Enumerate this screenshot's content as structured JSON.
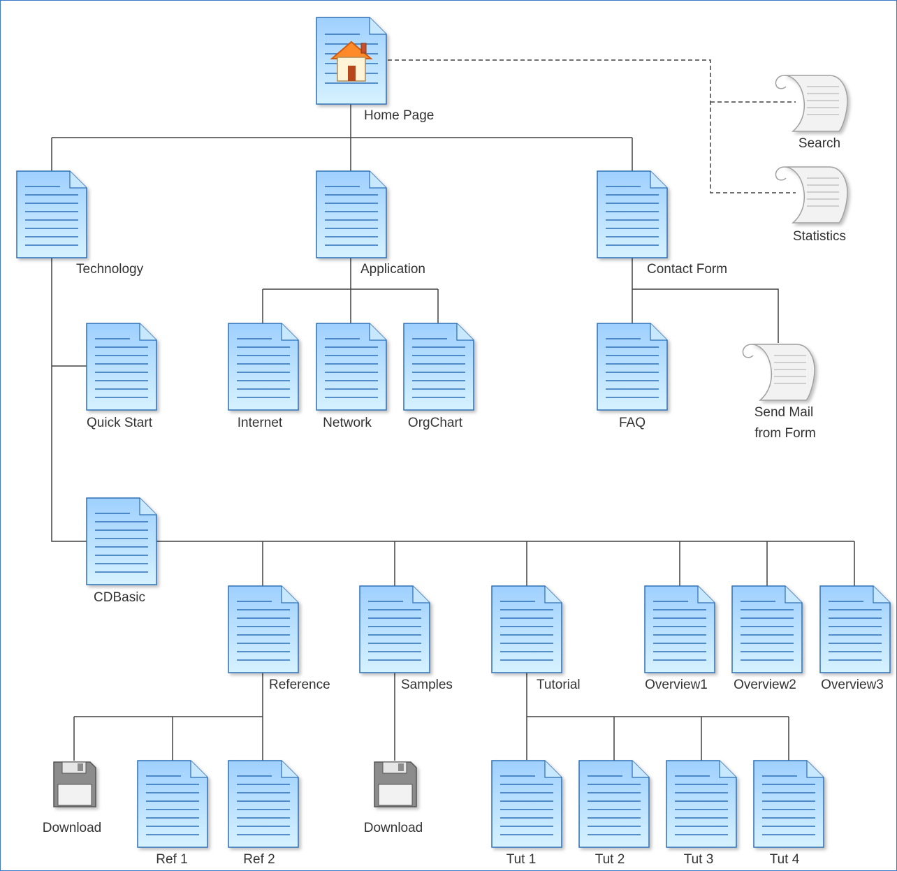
{
  "colors": {
    "doc_top": "#9fd0ff",
    "doc_bottom": "#d6f2ff",
    "doc_border": "#2d6fb5",
    "doc_lines": "#2d6fb5",
    "connector": "#404040",
    "scroll_fill": "#f2f2f2",
    "scroll_border": "#a0a0a0",
    "disk_fill": "#8c8c8c",
    "label_text": "#333333"
  },
  "nodes": {
    "home": {
      "label": "Home Page",
      "icon": "house-icon"
    },
    "technology": {
      "label": "Technology"
    },
    "application": {
      "label": "Application"
    },
    "contact": {
      "label": "Contact Form"
    },
    "search": {
      "label": "Search",
      "icon": "scroll-icon"
    },
    "statistics": {
      "label": "Statistics",
      "icon": "scroll-icon"
    },
    "quickstart": {
      "label": "Quick Start"
    },
    "internet": {
      "label": "Internet"
    },
    "network": {
      "label": "Network"
    },
    "orgchart": {
      "label": "OrgChart"
    },
    "faq": {
      "label": "FAQ"
    },
    "sendmail": {
      "label_line1": "Send Mail",
      "label_line2": "from Form",
      "icon": "scroll-icon"
    },
    "cdbasic": {
      "label": "CDBasic"
    },
    "reference": {
      "label": "Reference"
    },
    "samples": {
      "label": "Samples"
    },
    "tutorial": {
      "label": "Tutorial"
    },
    "overview1": {
      "label": "Overview1"
    },
    "overview2": {
      "label": "Overview2"
    },
    "overview3": {
      "label": "Overview3"
    },
    "download1": {
      "label": "Download",
      "icon": "floppy-disk-icon"
    },
    "ref1": {
      "label": "Ref 1"
    },
    "ref2": {
      "label": "Ref 2"
    },
    "download2": {
      "label": "Download",
      "icon": "floppy-disk-icon"
    },
    "tut1": {
      "label": "Tut 1"
    },
    "tut2": {
      "label": "Tut 2"
    },
    "tut3": {
      "label": "Tut 3"
    },
    "tut4": {
      "label": "Tut 4"
    }
  }
}
